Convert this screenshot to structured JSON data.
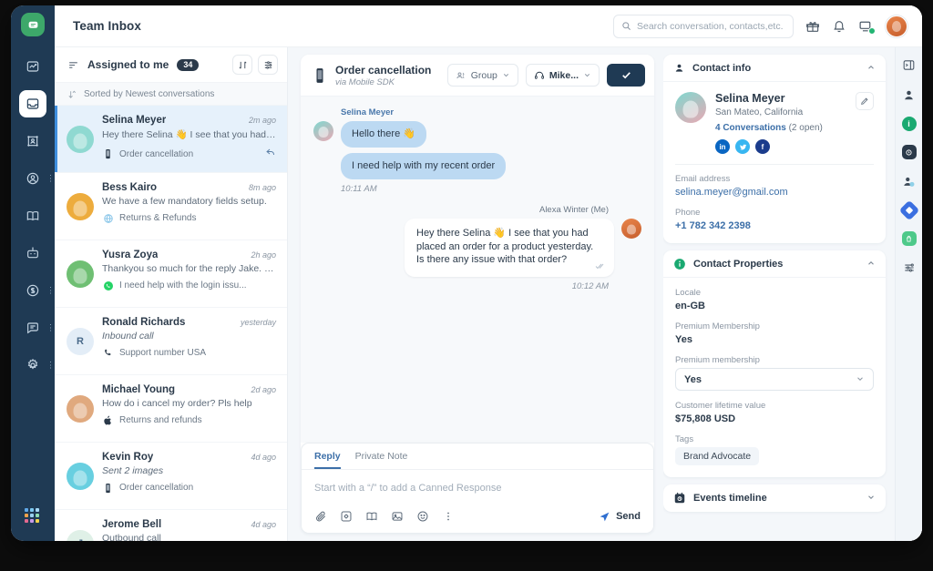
{
  "app": {
    "title": "Team Inbox",
    "logo_icon": "chat-bubble-logo"
  },
  "topbar": {
    "search_placeholder": "Search conversation, contacts,etc.",
    "search_icon": "search-icon",
    "icons": [
      "gift-icon",
      "bell-icon",
      "screen-share-icon"
    ],
    "avatar": "user-avatar"
  },
  "left_rail": {
    "items": [
      {
        "name": "reports-icon",
        "active": false,
        "has_menu": false
      },
      {
        "name": "inbox-icon",
        "active": true,
        "has_menu": false
      },
      {
        "name": "campaigns-icon",
        "active": false,
        "has_menu": false
      },
      {
        "name": "contacts-icon",
        "active": false,
        "has_menu": true
      },
      {
        "name": "knowledge-base-icon",
        "active": false,
        "has_menu": false
      },
      {
        "name": "bot-icon",
        "active": false,
        "has_menu": false
      },
      {
        "name": "billing-icon",
        "active": false,
        "has_menu": true
      },
      {
        "name": "messages-icon",
        "active": false,
        "has_menu": true
      },
      {
        "name": "settings-gear-icon",
        "active": false,
        "has_menu": true
      }
    ],
    "app_grid_icon": "app-grid-icon"
  },
  "conversation_list": {
    "header": {
      "filter_icon": "filter-icon",
      "title": "Assigned to me",
      "count": "34",
      "sort_button_icon": "sort-arrows-icon",
      "settings_button_icon": "list-settings-icon"
    },
    "sorted_by": {
      "icon": "sort-indicator-icon",
      "label": "Sorted by Newest conversations"
    },
    "items": [
      {
        "name": "Selina Meyer",
        "time": "2m ago",
        "preview": "Hey there Selina 👋 I see that you had p...",
        "preview_italic": false,
        "channel": "Order cancellation",
        "channel_icon": "mobile-sdk-icon",
        "selected": true,
        "has_reply_icon": true,
        "avatar_initial": "",
        "avatar_color": "#8fd9d1"
      },
      {
        "name": "Bess Kairo",
        "time": "8m ago",
        "preview": "We have a few mandatory fields setup.",
        "preview_italic": false,
        "channel": "Returns & Refunds",
        "channel_icon": "website-globe-icon",
        "selected": false,
        "has_reply_icon": false,
        "avatar_initial": "",
        "avatar_color": "#edac3d"
      },
      {
        "name": "Yusra Zoya",
        "time": "2h ago",
        "preview": "Thankyou so much for the reply Jake. Ca...",
        "preview_italic": false,
        "channel": "I need help with the login issu...",
        "channel_icon": "whatsapp-icon",
        "selected": false,
        "has_reply_icon": false,
        "avatar_initial": "",
        "avatar_color": "#6fbf73"
      },
      {
        "name": "Ronald Richards",
        "time": "yesterday",
        "preview": "Inbound call",
        "preview_italic": true,
        "channel": "Support number USA",
        "channel_icon": "phone-icon",
        "selected": false,
        "has_reply_icon": false,
        "avatar_initial": "R",
        "avatar_color": "#e3edf7"
      },
      {
        "name": "Michael Young",
        "time": "2d ago",
        "preview": "How do i cancel my order? Pls help",
        "preview_italic": false,
        "channel": "Returns and refunds",
        "channel_icon": "apple-icon",
        "selected": false,
        "has_reply_icon": false,
        "avatar_initial": "",
        "avatar_color": "#e0a97e"
      },
      {
        "name": "Kevin Roy",
        "time": "4d ago",
        "preview": "Sent 2 images",
        "preview_italic": true,
        "channel": "Order cancellation",
        "channel_icon": "mobile-sdk-icon",
        "selected": false,
        "has_reply_icon": false,
        "avatar_initial": "",
        "avatar_color": "#68cfe0"
      },
      {
        "name": "Jerome Bell",
        "time": "4d ago",
        "preview": "Outbound call",
        "preview_italic": false,
        "channel": "",
        "channel_icon": "",
        "selected": false,
        "has_reply_icon": false,
        "avatar_initial": "J",
        "avatar_color": "#dff0e7"
      }
    ]
  },
  "conversation": {
    "header": {
      "icon": "mobile-sdk-icon",
      "title": "Order cancellation",
      "subtitle": "via Mobile SDK",
      "group_button": {
        "label": "Group",
        "icon": "group-icon",
        "chevron": "chevron-down-icon"
      },
      "assignee_button": {
        "label": "Mike...",
        "icon": "headset-icon",
        "chevron": "chevron-down-icon"
      },
      "resolve_button_icon": "check-icon"
    },
    "messages": [
      {
        "sender": "Selina Meyer",
        "side": "left",
        "bubbles": [
          "Hello there 👋",
          "I need help with my recent order"
        ],
        "time": "10:11 AM"
      },
      {
        "sender": "Alexa Winter (Me)",
        "side": "right",
        "bubbles": [
          "Hey there Selina 👋 I see that you had placed an order for a product yesterday. Is there any issue with that order?"
        ],
        "time": "10:12 AM",
        "read_receipt_icon": "double-check-icon"
      }
    ],
    "composer": {
      "tabs": [
        {
          "label": "Reply",
          "active": true
        },
        {
          "label": "Private Note",
          "active": false
        }
      ],
      "placeholder": "Start with a “/” to add a Canned Response",
      "toolbar_icons": [
        "attachment-icon",
        "canned-response-icon",
        "knowledge-base-icon",
        "image-icon",
        "emoji-icon",
        "more-options-icon"
      ],
      "send_label": "Send",
      "send_icon": "send-icon"
    }
  },
  "right_panel": {
    "contact_info": {
      "header": "Contact info",
      "header_icon": "contact-info-icon",
      "collapse_icon": "chevron-up-icon",
      "name": "Selina Meyer",
      "location": "San Mateo, California",
      "conversations_link": "4 Conversations",
      "conversations_open": "(2 open)",
      "edit_icon": "pencil-edit-icon",
      "socials": [
        {
          "name": "linkedin-icon",
          "glyph": "in",
          "color": "#0a66c2"
        },
        {
          "name": "twitter-icon",
          "glyph": "t",
          "color": "#38b6f1"
        },
        {
          "name": "facebook-icon",
          "glyph": "f",
          "color": "#1b3c8c"
        }
      ],
      "fields": [
        {
          "label": "Email address",
          "value": "selina.meyer@gmail.com",
          "link": true
        },
        {
          "label": "Phone",
          "value": "+1 782 342 2398",
          "link": true
        }
      ]
    },
    "contact_properties": {
      "header": "Contact Properties",
      "header_icon": "info-circle-icon",
      "collapse_icon": "chevron-up-icon",
      "fields": [
        {
          "label": "Locale",
          "value": "en-GB",
          "type": "text"
        },
        {
          "label": "Premium Membership",
          "value": "Yes",
          "type": "text"
        },
        {
          "label": "Premium membership",
          "value": "Yes",
          "type": "select"
        },
        {
          "label": "Customer lifetime value",
          "value": "$75,808 USD",
          "type": "text"
        }
      ],
      "tags_label": "Tags",
      "tags": [
        "Brand Advocate"
      ]
    },
    "events_timeline": {
      "header": "Events timeline",
      "header_icon": "events-timeline-icon",
      "expand_icon": "chevron-down-icon"
    }
  },
  "right_rail": {
    "items": [
      {
        "name": "panel-toggle-icon",
        "style": "outline"
      },
      {
        "name": "agent-support-icon",
        "style": "plain"
      },
      {
        "name": "info-icon",
        "style": "chip",
        "color": "#1aa971"
      },
      {
        "name": "events-icon",
        "style": "chip",
        "color": "#2b3a4a"
      },
      {
        "name": "contact-icon",
        "style": "plain"
      },
      {
        "name": "integrations-diamond-icon",
        "style": "chip",
        "color": "#3b6fe0"
      },
      {
        "name": "shopify-icon",
        "style": "chip",
        "color": "#4ec98a"
      },
      {
        "name": "sliders-settings-icon",
        "style": "plain"
      }
    ]
  },
  "colors": {
    "rail_bg": "#1f3a54",
    "accent_blue": "#3c6fa8",
    "selected_row": "#e6f1fb",
    "bubble_in": "#bcd9f2",
    "resolve_btn": "#1f3a54",
    "green": "#1aa971"
  }
}
